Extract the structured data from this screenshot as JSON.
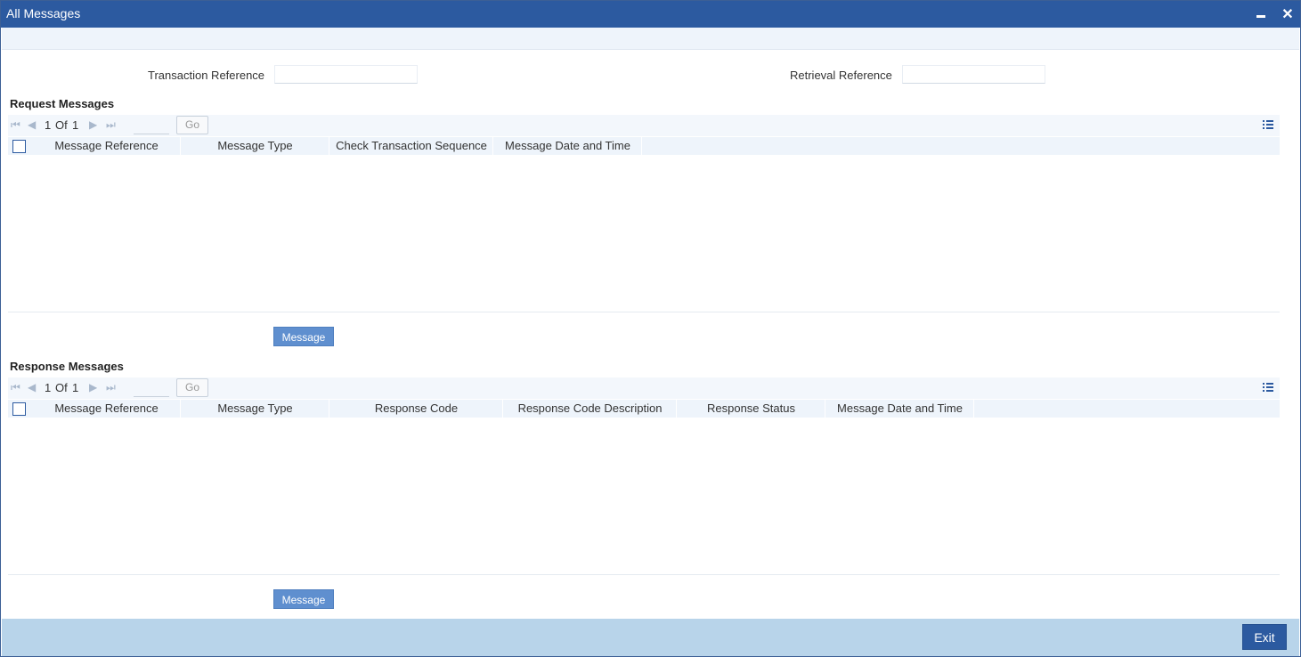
{
  "window": {
    "title": "All Messages"
  },
  "form": {
    "transaction_reference_label": "Transaction Reference",
    "transaction_reference_value": "",
    "retrieval_reference_label": "Retrieval Reference",
    "retrieval_reference_value": ""
  },
  "request": {
    "title": "Request Messages",
    "pager": {
      "current": "1",
      "of_label": "Of",
      "total": "1",
      "go_label": "Go",
      "page_input": ""
    },
    "columns": [
      "Message Reference",
      "Message Type",
      "Check Transaction Sequence",
      "Message Date and Time"
    ],
    "rows": [],
    "button_label": "Message"
  },
  "response": {
    "title": "Response Messages",
    "pager": {
      "current": "1",
      "of_label": "Of",
      "total": "1",
      "go_label": "Go",
      "page_input": ""
    },
    "columns": [
      "Message Reference",
      "Message Type",
      "Response Code",
      "Response Code Description",
      "Response Status",
      "Message Date and Time"
    ],
    "rows": [],
    "button_label": "Message"
  },
  "footer": {
    "exit_label": "Exit"
  },
  "colors": {
    "titlebar": "#2c5aa0",
    "footer": "#b8d4ea",
    "button": "#5f8fcf"
  }
}
